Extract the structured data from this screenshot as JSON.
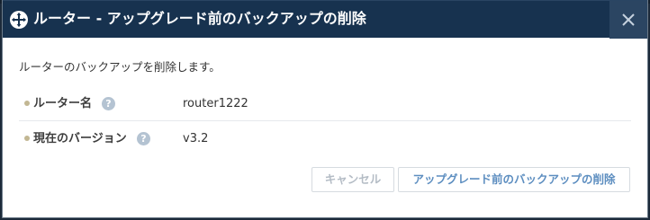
{
  "dialog": {
    "title": "ルーター - アップグレード前のバックアップの削除",
    "description": "ルーターのバックアップを削除します。",
    "fields": [
      {
        "label": "ルーター名",
        "value": "router1222"
      },
      {
        "label": "現在のバージョン",
        "value": "v3.2"
      }
    ],
    "help_glyph": "?",
    "buttons": {
      "cancel": "キャンセル",
      "confirm": "アップグレード前のバックアップの削除"
    }
  },
  "icons": {
    "header": "router-icon",
    "close": "close-icon",
    "help": "help-icon"
  },
  "colors": {
    "header_bg": "#17324f",
    "close_bg": "#2b4562",
    "bullet": "#c2b793",
    "help_icon": "#b4c3d2",
    "confirm_text": "#5d8ec0",
    "cancel_text": "#b4bcc5"
  }
}
